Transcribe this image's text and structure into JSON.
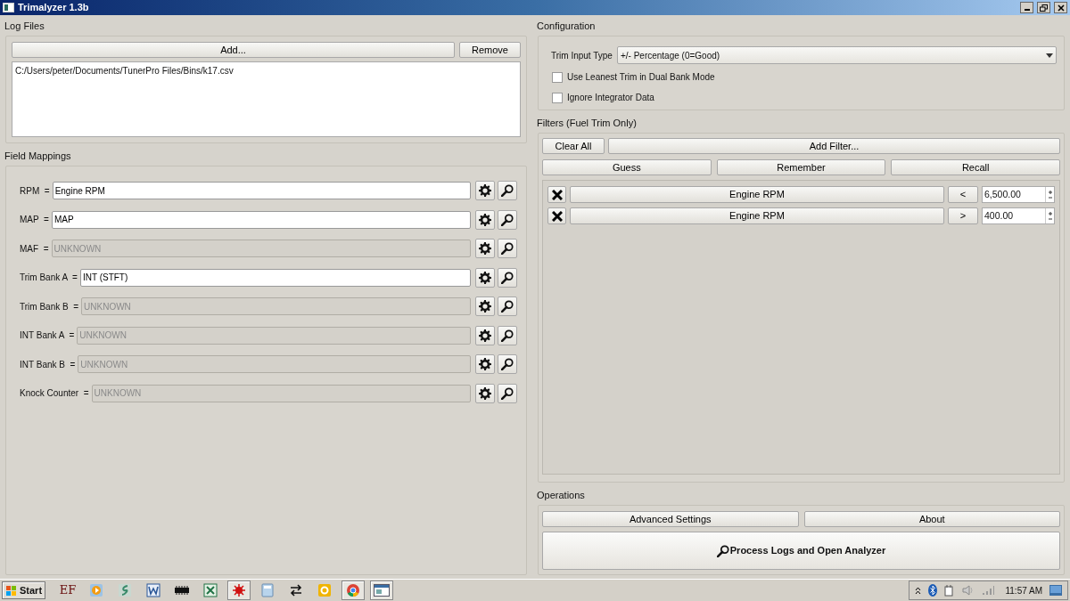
{
  "window": {
    "title": "Trimalyzer 1.3b"
  },
  "log_files": {
    "title": "Log Files",
    "buttons": [
      "Add...",
      "Remove"
    ],
    "files": [
      "C:/Users/peter/Documents/TunerPro Files/Bins/k17.csv"
    ]
  },
  "field_mappings": {
    "title": "Field Mappings",
    "rows": [
      {
        "label": "RPM  =",
        "value": "Engine RPM",
        "enabled": true
      },
      {
        "label": "MAP  =",
        "value": "MAP",
        "enabled": true
      },
      {
        "label": "MAF  =",
        "value": "UNKNOWN",
        "enabled": false
      },
      {
        "label": "Trim Bank A  =",
        "value": "INT (STFT)",
        "enabled": true
      },
      {
        "label": "Trim Bank B  =",
        "value": "UNKNOWN",
        "enabled": false
      },
      {
        "label": "INT Bank A  =",
        "value": "UNKNOWN",
        "enabled": false
      },
      {
        "label": "INT Bank B  =",
        "value": "UNKNOWN",
        "enabled": false
      },
      {
        "label": "Knock Counter  =",
        "value": "UNKNOWN",
        "enabled": false
      }
    ]
  },
  "configuration": {
    "title": "Configuration",
    "trim_input_label": "Trim Input Type",
    "trim_input_value": "+/- Percentage (0=Good)",
    "checkboxes": [
      {
        "label": "Use Leanest Trim in Dual Bank Mode",
        "checked": false
      },
      {
        "label": "Ignore Integrator Data",
        "checked": false
      }
    ]
  },
  "filters": {
    "title": "Filters (Fuel Trim Only)",
    "top_buttons": [
      "Clear All",
      "Add Filter..."
    ],
    "buttons": [
      "Guess",
      "Remember",
      "Recall"
    ],
    "rows": [
      {
        "field": "Engine RPM",
        "operator": "<",
        "value": "6,500.00"
      },
      {
        "field": "Engine RPM",
        "operator": ">",
        "value": "400.00"
      }
    ]
  },
  "operations": {
    "title": "Operations",
    "buttons": [
      "Advanced Settings",
      "About"
    ],
    "main_button": "Process Logs and Open Analyzer"
  },
  "taskbar": {
    "start": "Start",
    "items": [
      {
        "kind": "text",
        "label": "EF",
        "selected": false
      },
      {
        "kind": "media",
        "selected": false
      },
      {
        "kind": "swirl",
        "selected": false
      },
      {
        "kind": "word",
        "selected": false
      },
      {
        "kind": "chip",
        "selected": false
      },
      {
        "kind": "excel",
        "selected": false
      },
      {
        "kind": "splat",
        "selected": true
      },
      {
        "kind": "calculator",
        "selected": false
      },
      {
        "kind": "arrows",
        "selected": false
      },
      {
        "kind": "outlook",
        "selected": false
      },
      {
        "kind": "chrome",
        "selected": true
      },
      {
        "kind": "window",
        "selected": true
      }
    ],
    "clock": "11:57 AM"
  }
}
